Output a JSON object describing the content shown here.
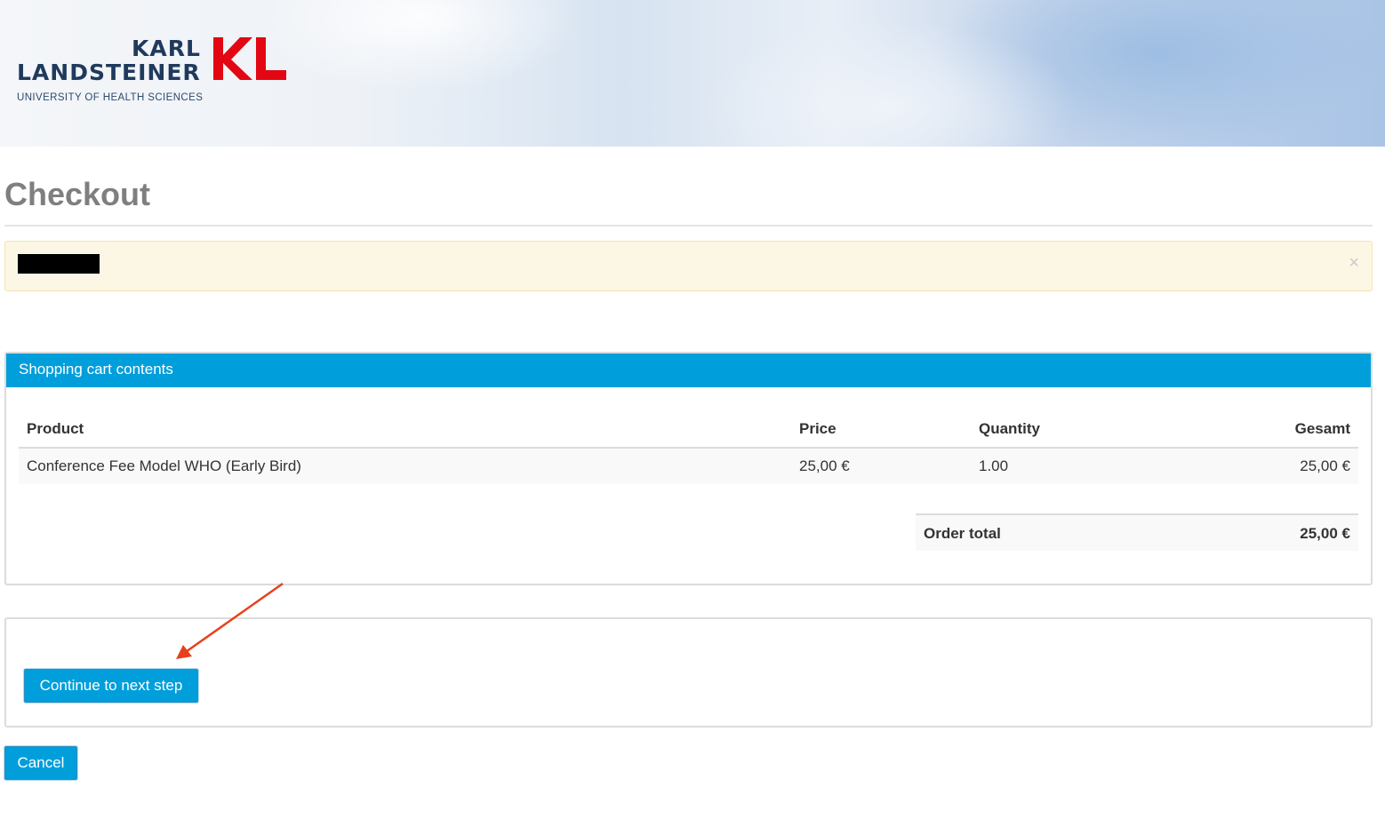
{
  "header": {
    "logo_line1": "KARL",
    "logo_line2": "LANDSTEINER",
    "logo_line3": "UNIVERSITY OF HEALTH SCIENCES",
    "logo_mark": "KL",
    "brand_color": "#e30613",
    "navy_color": "#1f3a5c"
  },
  "page": {
    "title": "Checkout"
  },
  "alert": {
    "message": "[redacted]",
    "close_glyph": "×",
    "close_icon": "close-icon"
  },
  "cart": {
    "panel_title": "Shopping cart contents",
    "accent_color": "#009edb",
    "columns": [
      "Product",
      "Price",
      "Quantity",
      "Gesamt"
    ],
    "rows": [
      {
        "product": "Conference Fee Model WHO (Early Bird)",
        "price": "25,00 €",
        "quantity": "1.00",
        "total": "25,00 €"
      }
    ],
    "order_total_label": "Order total",
    "order_total_value": "25,00 €"
  },
  "actions": {
    "continue_label": "Continue to next step",
    "cancel_label": "Cancel"
  },
  "annotation": {
    "arrow_color": "#e8401c",
    "arrow_icon": "arrow-annotation-icon"
  }
}
